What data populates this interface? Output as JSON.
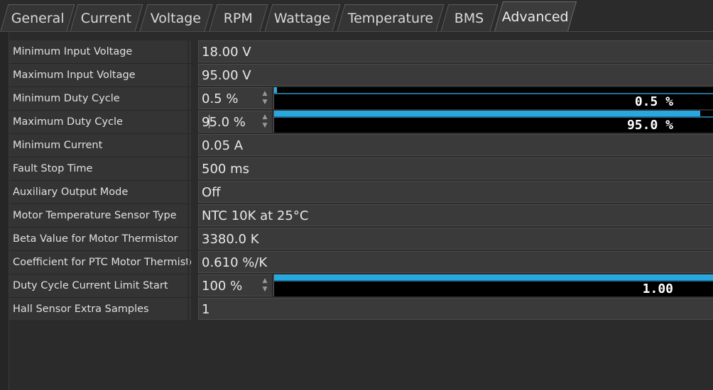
{
  "tabs": [
    {
      "label": "General"
    },
    {
      "label": "Current"
    },
    {
      "label": "Voltage"
    },
    {
      "label": "RPM"
    },
    {
      "label": "Wattage"
    },
    {
      "label": "Temperature"
    },
    {
      "label": "BMS"
    },
    {
      "label": "Advanced",
      "active": true
    }
  ],
  "rows": [
    {
      "label": "Minimum Input Voltage",
      "value": "18.00 V"
    },
    {
      "label": "Maximum Input Voltage",
      "value": "95.00 V"
    },
    {
      "label": "Minimum Duty Cycle",
      "value": "0.5 %",
      "bar_text": "0.5 %",
      "bar_fraction": 0.005
    },
    {
      "label": "Maximum Duty Cycle",
      "value_before_cursor": "9",
      "value_after_cursor": "5.0 %",
      "bar_text": "95.0 %",
      "bar_fraction": 0.95
    },
    {
      "label": "Minimum Current",
      "value": "0.05 A"
    },
    {
      "label": "Fault Stop Time",
      "value": "500 ms"
    },
    {
      "label": "Auxiliary Output Mode",
      "value": "Off"
    },
    {
      "label": "Motor Temperature Sensor Type",
      "value": "NTC 10K at 25°C"
    },
    {
      "label": "Beta Value for Motor Thermistor",
      "value": "3380.0 K"
    },
    {
      "label": "Coefficient for PTC Motor Thermistor",
      "value": "0.610 %/K"
    },
    {
      "label": "Duty Cycle Current Limit Start",
      "value": "100 %",
      "bar_text": "1.00",
      "bar_fraction": 1.0
    },
    {
      "label": "Hall Sensor Extra Samples",
      "value": "1"
    }
  ],
  "colors": {
    "accent": "#29a8e0",
    "background": "#2b2b2b"
  },
  "icons": {
    "spin_up": "up-arrow-icon",
    "spin_down": "down-arrow-icon"
  }
}
